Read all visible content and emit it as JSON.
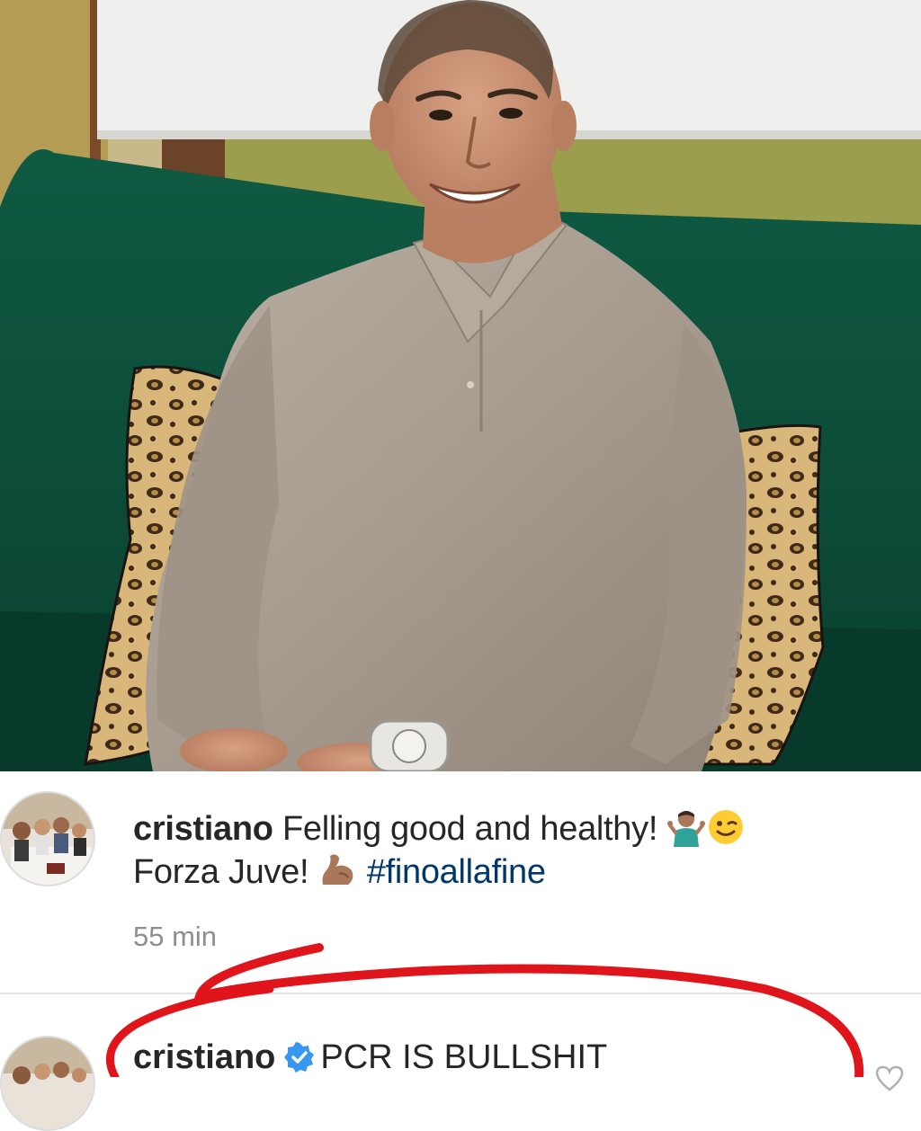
{
  "post": {
    "image": {
      "description_icon": "photo"
    },
    "caption": {
      "username": "cristiano",
      "line1_text": "Felling good and healthy!",
      "line1_emojis": [
        "person-shrugging-icon",
        "winking-face-icon"
      ],
      "line2_text": "Forza Juve!",
      "line2_emoji": "flexed-biceps-icon",
      "hashtag": "#finoallafine",
      "timestamp": "55 min"
    },
    "comment": {
      "username": "cristiano",
      "verified_icon": "verified-badge-icon",
      "text": "PCR IS BULLSHIT",
      "like_icon": "heart-outline-icon"
    }
  },
  "colors": {
    "text_primary": "#262626",
    "text_secondary": "#8e8e8e",
    "hashtag": "#00376b",
    "verified": "#3897f0",
    "annotation_red": "#e0141b"
  }
}
